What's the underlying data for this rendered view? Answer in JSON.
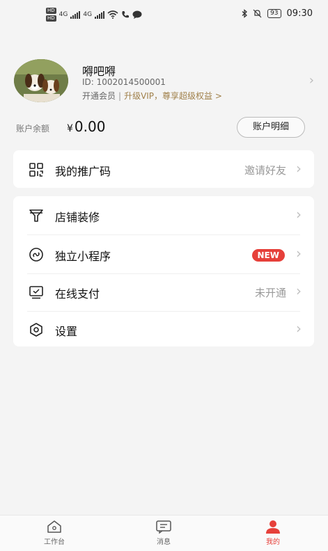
{
  "status_bar": {
    "hd1": "HD",
    "hd2": "HD",
    "net1": "4G",
    "net2": "4G",
    "battery": "93",
    "time": "09:30"
  },
  "profile": {
    "name": "嘚吧嘚",
    "id": "ID: 1002014500001",
    "member": "开通会员",
    "separator": "|",
    "vip_link": "升级VIP，尊享超级权益 >"
  },
  "balance": {
    "label": "账户余额",
    "currency": "¥",
    "amount": "0.00",
    "detail_button": "账户明细"
  },
  "promo": {
    "label": "我的推广码",
    "value": "邀请好友"
  },
  "menu": {
    "store_decoration": {
      "label": "店铺装修"
    },
    "mini_program": {
      "label": "独立小程序",
      "badge": "NEW"
    },
    "online_payment": {
      "label": "在线支付",
      "value": "未开通"
    },
    "settings": {
      "label": "设置"
    }
  },
  "tabbar": {
    "workbench": "工作台",
    "messages": "消息",
    "mine": "我的"
  },
  "colors": {
    "accent": "#e6403a",
    "vip_gold": "#a0804a"
  }
}
